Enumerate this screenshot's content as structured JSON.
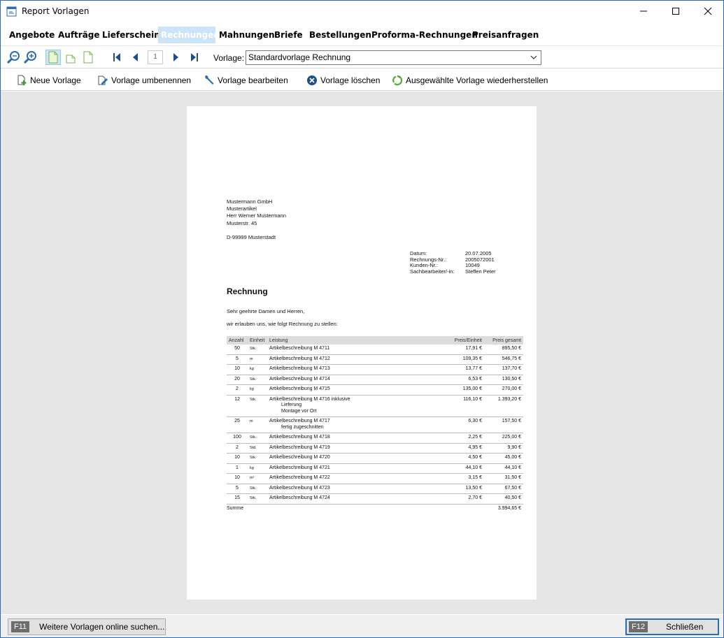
{
  "window": {
    "title": "Report Vorlagen"
  },
  "menu": [
    "Angebote",
    "Aufträge",
    "Lieferscheine",
    "Rechnungen",
    "Mahnungen",
    "Briefe",
    "Bestellungen",
    "Proforma-Rechnungen",
    "Preisanfragen"
  ],
  "menu_active": 3,
  "toolbar": {
    "page_number": "1",
    "vorlage_label": "Vorlage:",
    "vorlage_value": "Standardvorlage Rechnung"
  },
  "actions": {
    "new": "Neue Vorlage",
    "rename": "Vorlage umbenennen",
    "edit": "Vorlage bearbeiten",
    "delete": "Vorlage löschen",
    "restore": "Ausgewählte Vorlage wiederherstellen"
  },
  "doc": {
    "address": [
      "Mustermann GmbH",
      "Musterartikel",
      "Herr Werner Mustermann",
      "Musterstr. 45"
    ],
    "city": "D-99999 Musterstadt",
    "meta": [
      [
        "Datum:",
        "20.07.2005"
      ],
      [
        "Rechnungs-Nr.:",
        "2005072001"
      ],
      [
        "Kunden-Nr.:",
        "10049"
      ],
      [
        "Sachbearbeiter/-in:",
        "Steffen Peter"
      ]
    ],
    "title": "Rechnung",
    "greeting": "Sehr geehrte Damen und Herren,",
    "intro": "wir erlauben uns, wie folgt Rechnung zu stellen:",
    "headers": {
      "qty": "Anzahl",
      "unit": "Einheit",
      "desc": "Leistung",
      "price": "Preis/Einheit",
      "total": "Preis gesamt"
    },
    "items": [
      {
        "qty": "50",
        "unit": "Stk.",
        "desc": "Artikelbeschreibung  M 4711",
        "price": "17,91 €",
        "total": "895,50 €"
      },
      {
        "qty": "5",
        "unit": "m",
        "desc": "Artikelbeschreibung  M 4712",
        "price": "109,35 €",
        "total": "546,75 €"
      },
      {
        "qty": "10",
        "unit": "kg",
        "desc": "Artikelbeschreibung  M 4713",
        "price": "13,77 €",
        "total": "137,70 €"
      },
      {
        "qty": "20",
        "unit": "Stk.",
        "desc": "Artikelbeschreibung M 4714",
        "price": "6,53 €",
        "total": "130,50 €"
      },
      {
        "qty": "2",
        "unit": "kg",
        "desc": "Artikelbeschreibung M 4715",
        "price": "135,00 €",
        "total": "270,00 €"
      },
      {
        "qty": "12",
        "unit": "Stk.",
        "desc": "Artikelbeschreibung M 4716 inklusive",
        "desc2": "Lieferung",
        "desc3": "Montage vor Ort",
        "price": "116,10 €",
        "total": "1.393,20 €"
      },
      {
        "qty": "25",
        "unit": "m",
        "desc": "Artikelbeschreibung M 4717",
        "desc2": "fertig zugeschnitten",
        "price": "6,30 €",
        "total": "157,50 €"
      },
      {
        "qty": "100",
        "unit": "Stk.",
        "desc": "Artikelbeschreibung  M 4718",
        "price": "2,25 €",
        "total": "225,00 €"
      },
      {
        "qty": "2",
        "unit": "Std.",
        "desc": "Artikelbeschreibung M 4719",
        "price": "4,95 €",
        "total": "9,90 €"
      },
      {
        "qty": "10",
        "unit": "Stk.",
        "desc": "Artikelbeschreibung M 4720",
        "price": "4,50 €",
        "total": "45,00 €"
      },
      {
        "qty": "1",
        "unit": "kg",
        "desc": "Artikelbeschreibung M 4721",
        "price": "44,10 €",
        "total": "44,10 €"
      },
      {
        "qty": "10",
        "unit": "m²",
        "desc": "Artikelbeschreibung M 4722",
        "price": "3,15 €",
        "total": "31,50 €"
      },
      {
        "qty": "5",
        "unit": "Stk.",
        "desc": "Artikelbeschreibung M 4723",
        "price": "13,50 €",
        "total": "67,50 €"
      },
      {
        "qty": "15",
        "unit": "Stk.",
        "desc": "Artikelbeschreibung M 4724",
        "price": "2,70 €",
        "total": "40,50 €"
      }
    ],
    "sum_label": "Summe",
    "sum_value": "3.994,65 €"
  },
  "footer": {
    "f11_key": "F11",
    "f11_label": "Weitere Vorlagen online suchen...",
    "f12_key": "F12",
    "f12_label": "Schließen"
  }
}
